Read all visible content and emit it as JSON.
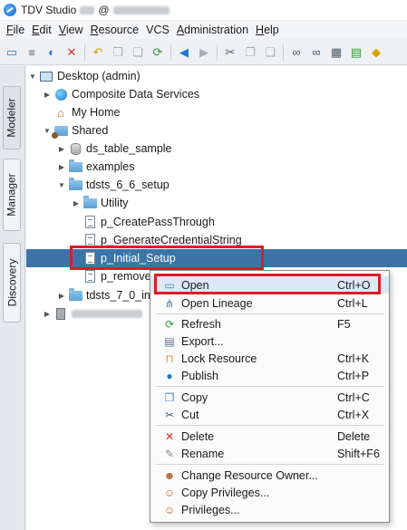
{
  "window": {
    "title": "TDV Studio",
    "title_separator": "@"
  },
  "menu": [
    {
      "label": "File",
      "mnemonic": "F",
      "rest": "ile"
    },
    {
      "label": "Edit",
      "mnemonic": "E",
      "rest": "dit"
    },
    {
      "label": "View",
      "mnemonic": "V",
      "rest": "iew"
    },
    {
      "label": "Resource",
      "mnemonic": "R",
      "rest": "esource"
    },
    {
      "label": "VCS",
      "mnemonic": "",
      "rest": "VCS"
    },
    {
      "label": "Administration",
      "mnemonic": "A",
      "rest": "dministration"
    },
    {
      "label": "Help",
      "mnemonic": "H",
      "rest": "elp"
    }
  ],
  "side_tabs": {
    "modeler": "Modeler",
    "manager": "Manager",
    "discovery": "Discovery"
  },
  "tree": {
    "desktop": "Desktop (admin)",
    "composite_data_services": "Composite Data Services",
    "my_home": "My Home",
    "shared": "Shared",
    "ds_table_sample": "ds_table_sample",
    "examples": "examples",
    "tdsts_6_6_setup": "tdsts_6_6_setup",
    "utility": "Utility",
    "p_create_pass_through": "p_CreatePassThrough",
    "p_generate_credential_string": "p_GenerateCredentialString",
    "p_initial_setup": "p_Initial_Setup",
    "p_remove": "p_removeF",
    "tdsts_7_0": "tdsts_7_0_in"
  },
  "context_menu": {
    "open": {
      "label": "Open",
      "shortcut": "Ctrl+O"
    },
    "open_lineage": {
      "label": "Open Lineage",
      "shortcut": "Ctrl+L"
    },
    "refresh": {
      "label": "Refresh",
      "shortcut": "F5"
    },
    "export": {
      "label": "Export...",
      "shortcut": ""
    },
    "lock_resource": {
      "label": "Lock Resource",
      "shortcut": "Ctrl+K"
    },
    "publish": {
      "label": "Publish",
      "shortcut": "Ctrl+P"
    },
    "copy": {
      "label": "Copy",
      "shortcut": "Ctrl+C"
    },
    "cut": {
      "label": "Cut",
      "shortcut": "Ctrl+X"
    },
    "delete": {
      "label": "Delete",
      "shortcut": "Delete"
    },
    "rename": {
      "label": "Rename",
      "shortcut": "Shift+F6"
    },
    "change_owner": {
      "label": "Change Resource Owner...",
      "shortcut": ""
    },
    "copy_privileges": {
      "label": "Copy Privileges...",
      "shortcut": ""
    },
    "privileges": {
      "label": "Privileges...",
      "shortcut": ""
    }
  },
  "colors": {
    "selection": "#3d74a8",
    "highlight_box": "#e01b24"
  },
  "icons": {
    "toolbar": [
      "open-folder-icon",
      "save-icon",
      "refresh-icon",
      "delete-icon",
      "undo-icon",
      "copy-icon",
      "paste-icon",
      "sync-icon",
      "back-icon",
      "forward-icon",
      "cut-icon",
      "duplicate-icon",
      "paste-icon",
      "binoculars-icon",
      "binoculars-icon",
      "grid-icon",
      "export-icon",
      "tag-icon"
    ]
  }
}
